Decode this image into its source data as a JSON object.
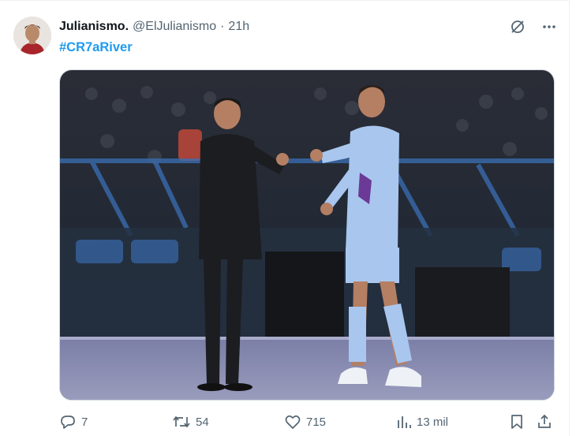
{
  "tweet": {
    "display_name": "Julianismo.",
    "handle": "@ElJulianismo",
    "separator": "·",
    "time": "21h",
    "hashtag": "#CR7aRiver"
  },
  "top_icons": [
    "grok-icon",
    "more-icon"
  ],
  "media": {
    "subject_left": {
      "jersey_color": "#1c1d21"
    },
    "subject_right": {
      "jersey_color": "#a9c6ee",
      "shorts_color": "#a9c6ee",
      "socks_color": "#a9c6ee"
    },
    "field_color": "#8c8fb3"
  },
  "actions": {
    "replies": "7",
    "retweets": "54",
    "likes": "715",
    "views": "13 mil"
  },
  "colors": {
    "accent": "#1d9bf0",
    "muted": "#536471",
    "text": "#0f1419"
  }
}
